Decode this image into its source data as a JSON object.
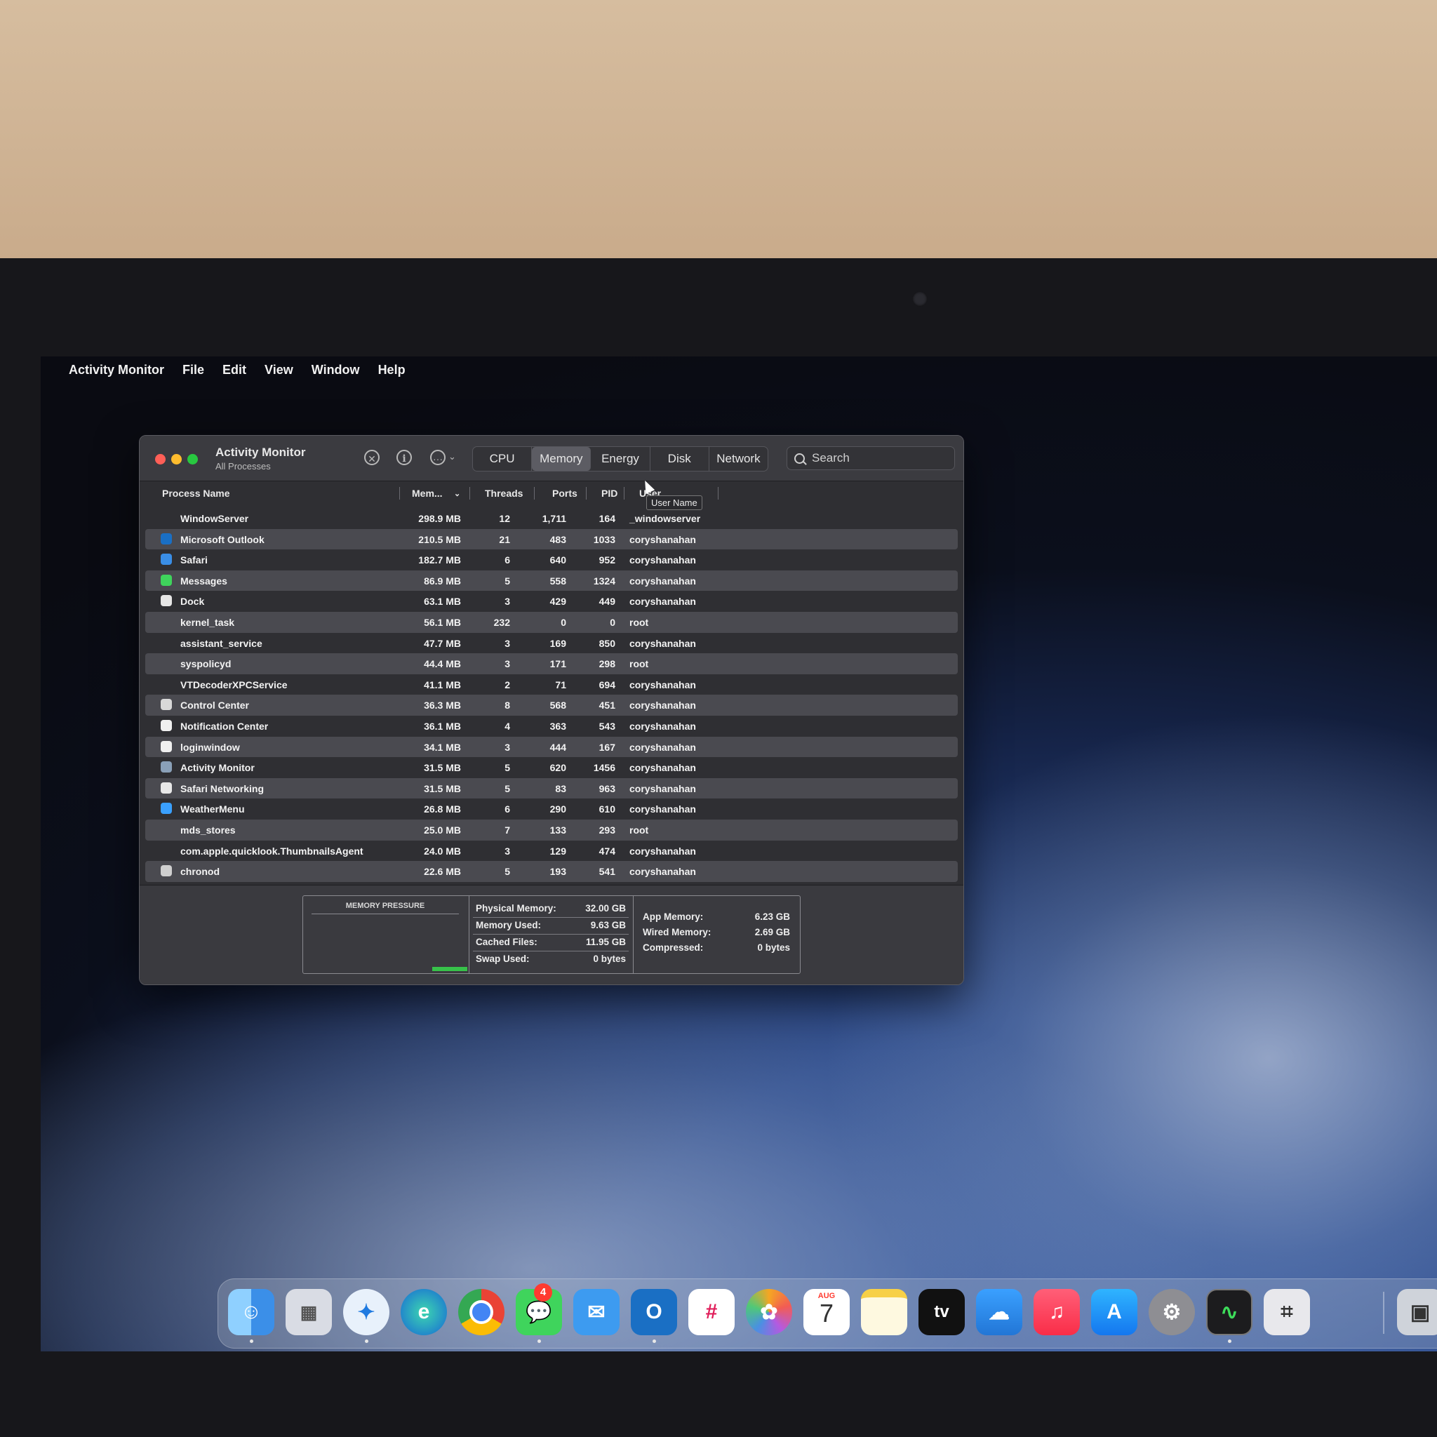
{
  "menubar": {
    "app_name": "Activity Monitor",
    "items": [
      "File",
      "Edit",
      "View",
      "Window",
      "Help"
    ]
  },
  "window": {
    "title": "Activity Monitor",
    "subtitle": "All Processes",
    "tabs": [
      "CPU",
      "Memory",
      "Energy",
      "Disk",
      "Network"
    ],
    "active_tab": "Memory",
    "search_placeholder": "Search"
  },
  "table": {
    "columns": [
      "Process Name",
      "Mem...",
      "Threads",
      "Ports",
      "PID",
      "User"
    ],
    "tooltip": "User Name",
    "rows": [
      {
        "name": "WindowServer",
        "mem": "298.9 MB",
        "threads": "12",
        "ports": "1,711",
        "pid": "164",
        "user": "_windowserver",
        "icon": "none"
      },
      {
        "name": "Microsoft Outlook",
        "mem": "210.5 MB",
        "threads": "21",
        "ports": "483",
        "pid": "1033",
        "user": "coryshanahan",
        "icon": "outlook-icon"
      },
      {
        "name": "Safari",
        "mem": "182.7 MB",
        "threads": "6",
        "ports": "640",
        "pid": "952",
        "user": "coryshanahan",
        "icon": "safari-icon"
      },
      {
        "name": "Messages",
        "mem": "86.9 MB",
        "threads": "5",
        "ports": "558",
        "pid": "1324",
        "user": "coryshanahan",
        "icon": "messages-icon"
      },
      {
        "name": "Dock",
        "mem": "63.1 MB",
        "threads": "3",
        "ports": "429",
        "pid": "449",
        "user": "coryshanahan",
        "icon": "dock-icon"
      },
      {
        "name": "kernel_task",
        "mem": "56.1 MB",
        "threads": "232",
        "ports": "0",
        "pid": "0",
        "user": "root",
        "icon": "none"
      },
      {
        "name": "assistant_service",
        "mem": "47.7 MB",
        "threads": "3",
        "ports": "169",
        "pid": "850",
        "user": "coryshanahan",
        "icon": "none"
      },
      {
        "name": "syspolicyd",
        "mem": "44.4 MB",
        "threads": "3",
        "ports": "171",
        "pid": "298",
        "user": "root",
        "icon": "none"
      },
      {
        "name": "VTDecoderXPCService",
        "mem": "41.1 MB",
        "threads": "2",
        "ports": "71",
        "pid": "694",
        "user": "coryshanahan",
        "icon": "none"
      },
      {
        "name": "Control Center",
        "mem": "36.3 MB",
        "threads": "8",
        "ports": "568",
        "pid": "451",
        "user": "coryshanahan",
        "icon": "control-center-icon"
      },
      {
        "name": "Notification Center",
        "mem": "36.1 MB",
        "threads": "4",
        "ports": "363",
        "pid": "543",
        "user": "coryshanahan",
        "icon": "notification-center-icon"
      },
      {
        "name": "loginwindow",
        "mem": "34.1 MB",
        "threads": "3",
        "ports": "444",
        "pid": "167",
        "user": "coryshanahan",
        "icon": "loginwindow-icon"
      },
      {
        "name": "Activity Monitor",
        "mem": "31.5 MB",
        "threads": "5",
        "ports": "620",
        "pid": "1456",
        "user": "coryshanahan",
        "icon": "activity-monitor-icon"
      },
      {
        "name": "Safari Networking",
        "mem": "31.5 MB",
        "threads": "5",
        "ports": "83",
        "pid": "963",
        "user": "coryshanahan",
        "icon": "shield-icon"
      },
      {
        "name": "WeatherMenu",
        "mem": "26.8 MB",
        "threads": "6",
        "ports": "290",
        "pid": "610",
        "user": "coryshanahan",
        "icon": "weather-icon"
      },
      {
        "name": "mds_stores",
        "mem": "25.0 MB",
        "threads": "7",
        "ports": "133",
        "pid": "293",
        "user": "root",
        "icon": "none"
      },
      {
        "name": "com.apple.quicklook.ThumbnailsAgent",
        "mem": "24.0 MB",
        "threads": "3",
        "ports": "129",
        "pid": "474",
        "user": "coryshanahan",
        "icon": "none"
      },
      {
        "name": "chronod",
        "mem": "22.6 MB",
        "threads": "5",
        "ports": "193",
        "pid": "541",
        "user": "coryshanahan",
        "icon": "chronod-icon"
      }
    ]
  },
  "memory_panel": {
    "pressure_label": "MEMORY PRESSURE",
    "pressure_level": 0.1,
    "left_stats": [
      {
        "label": "Physical Memory:",
        "value": "32.00 GB"
      },
      {
        "label": "Memory Used:",
        "value": "9.63 GB"
      },
      {
        "label": "Cached Files:",
        "value": "11.95 GB"
      },
      {
        "label": "Swap Used:",
        "value": "0 bytes"
      }
    ],
    "right_stats": [
      {
        "label": "App Memory:",
        "value": "6.23 GB"
      },
      {
        "label": "Wired Memory:",
        "value": "2.69 GB"
      },
      {
        "label": "Compressed:",
        "value": "0 bytes"
      }
    ]
  },
  "dock": {
    "messages_badge": "4",
    "calendar_month": "AUG",
    "calendar_day": "7",
    "tv_label": "tv",
    "items": [
      "finder-icon",
      "launchpad-icon",
      "safari-icon",
      "edge-icon",
      "chrome-icon",
      "messages-icon",
      "mail-icon",
      "outlook-icon",
      "slack-icon",
      "photos-icon",
      "calendar-icon",
      "notes-icon",
      "apple-tv-icon",
      "weather-icon",
      "music-icon",
      "app-store-icon",
      "system-settings-icon",
      "activity-monitor-icon",
      "screenshot-icon",
      "image-capture-icon",
      "facetime-icon"
    ]
  }
}
